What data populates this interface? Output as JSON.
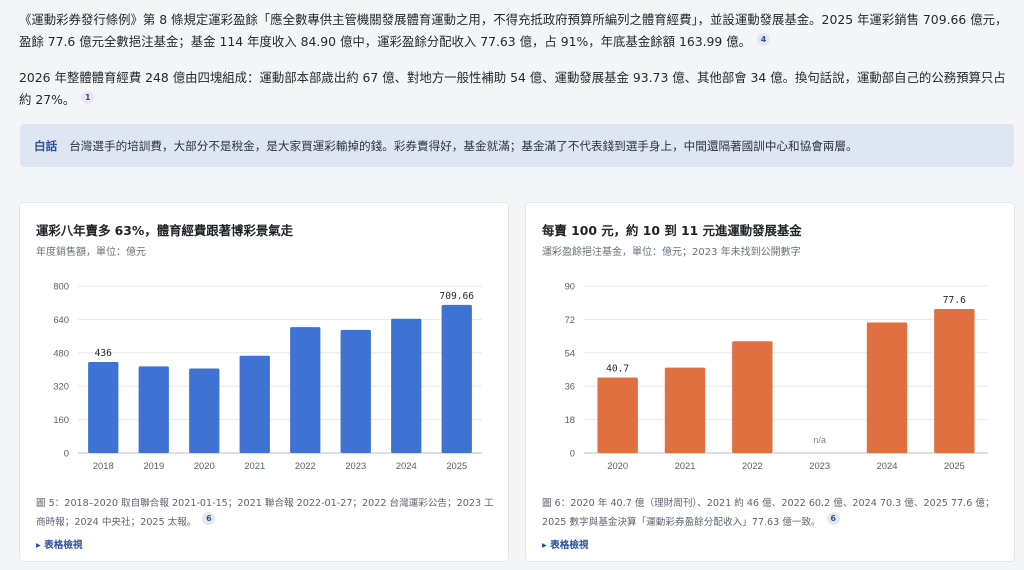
{
  "intro": {
    "p1": "《運動彩券發行條例》第 8 條規定運彩盈餘「應全數專供主管機關發展體育運動之用，不得充抵政府預算所編列之體育經費」，並設運動發展基金。2025 年運彩銷售 709.66 億元，盈餘 77.6 億元全數挹注基金；基金 114 年度收入 84.90 億中，運彩盈餘分配收入 77.63 億，占 91%，年底基金餘額 163.99 億。",
    "p1_ref": "4",
    "p2": "2026 年整體體育經費 248 億由四塊組成：運動部本部歲出約 67 億、對地方一般性補助 54 億、運動發展基金 93.73 億、其他部會 34 億。換句話說，運動部自己的公務預算只占約 27%。",
    "p2_ref": "1"
  },
  "plain": {
    "tag": "白話",
    "text": "台灣選手的培訓費，大部分不是稅金，是大家買運彩輸掉的錢。彩券賣得好，基金就滿；基金滿了不代表錢到選手身上，中間還隔著國訓中心和協會兩層。"
  },
  "colors": {
    "bar1": "#3f73d3",
    "bar2": "#e0703f",
    "grid": "#e6e8eb",
    "axis": "#b7bcc4"
  },
  "charts": [
    {
      "title": "運彩八年賣多 63%，體育經費跟著博彩景氣走",
      "subtitle": "年度銷售額，單位：億元",
      "note": "圖 5：2018–2020 取自聯合報 2021-01-15；2021 聯合報 2022-01-27；2022 台灣運彩公告；2023 工商時報；2024 中央社；2025 太報。",
      "note_ref": "6",
      "toggle": "▸ 表格檢視"
    },
    {
      "title": "每賣 100 元，約 10 到 11 元進運動發展基金",
      "subtitle": "運彩盈餘挹注基金，單位：億元；2023 年未找到公開數字",
      "note": "圖 6：2020 年 40.7 億（理財周刊）、2021 約 46 億、2022 60.2 億、2024 70.3 億、2025 77.6 億；2025 數字與基金決算「運動彩券盈餘分配收入」77.63 億一致。",
      "note_ref": "6",
      "toggle": "▸ 表格檢視"
    }
  ],
  "chart_data": [
    {
      "type": "bar",
      "title": "運彩八年賣多 63%，體育經費跟著博彩景氣走",
      "ylabel": "億元",
      "categories": [
        "2018",
        "2019",
        "2020",
        "2021",
        "2022",
        "2023",
        "2024",
        "2025"
      ],
      "values": [
        436,
        415,
        405,
        466,
        603,
        590,
        643,
        709.66
      ],
      "labels": [
        "436",
        null,
        null,
        null,
        null,
        null,
        null,
        "709.66"
      ],
      "ylim": [
        0,
        800
      ],
      "yticks": [
        0,
        160,
        320,
        480,
        640,
        800
      ],
      "grid": true
    },
    {
      "type": "bar",
      "title": "每賣 100 元，約 10 到 11 元進運動發展基金",
      "ylabel": "億元",
      "categories": [
        "2020",
        "2021",
        "2022",
        "2023",
        "2024",
        "2025"
      ],
      "values": [
        40.7,
        46,
        60.2,
        null,
        70.3,
        77.6
      ],
      "labels": [
        "40.7",
        null,
        null,
        "n/a",
        null,
        "77.6"
      ],
      "ylim": [
        0,
        90
      ],
      "yticks": [
        0,
        18,
        36,
        54,
        72,
        90
      ],
      "grid": true
    }
  ]
}
